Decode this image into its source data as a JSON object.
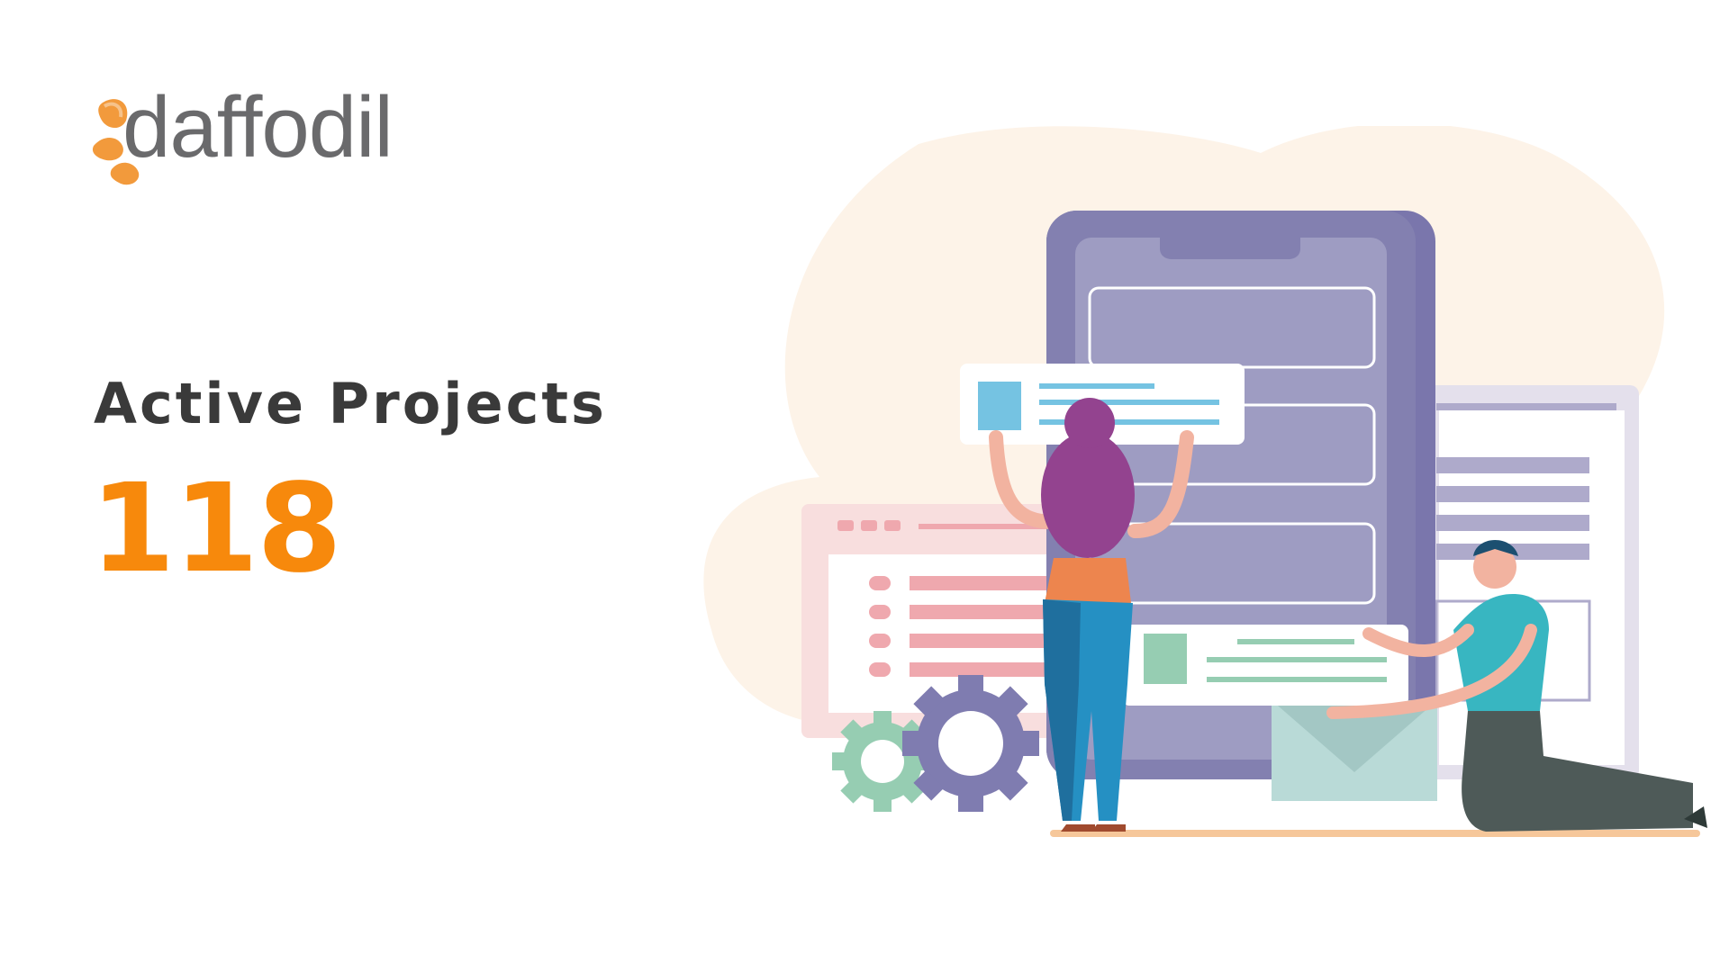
{
  "brand": {
    "name": "daffodil",
    "logo_color": "#f29a3c",
    "text_color": "#6a6a6c"
  },
  "stat": {
    "label": "Active Projects",
    "value": "118",
    "value_color": "#f7890c"
  },
  "illustration": {
    "icon": "team-app-development-illustration",
    "colors": {
      "blob": "#fdf3e8",
      "phone": "#8380b0",
      "phone_screen": "#9e9cc2",
      "pink_panel": "#f8dede",
      "lilac_panel": "#e4e0ec",
      "gear_green": "#96cdb2",
      "gear_purple": "#7f7cb0"
    }
  }
}
